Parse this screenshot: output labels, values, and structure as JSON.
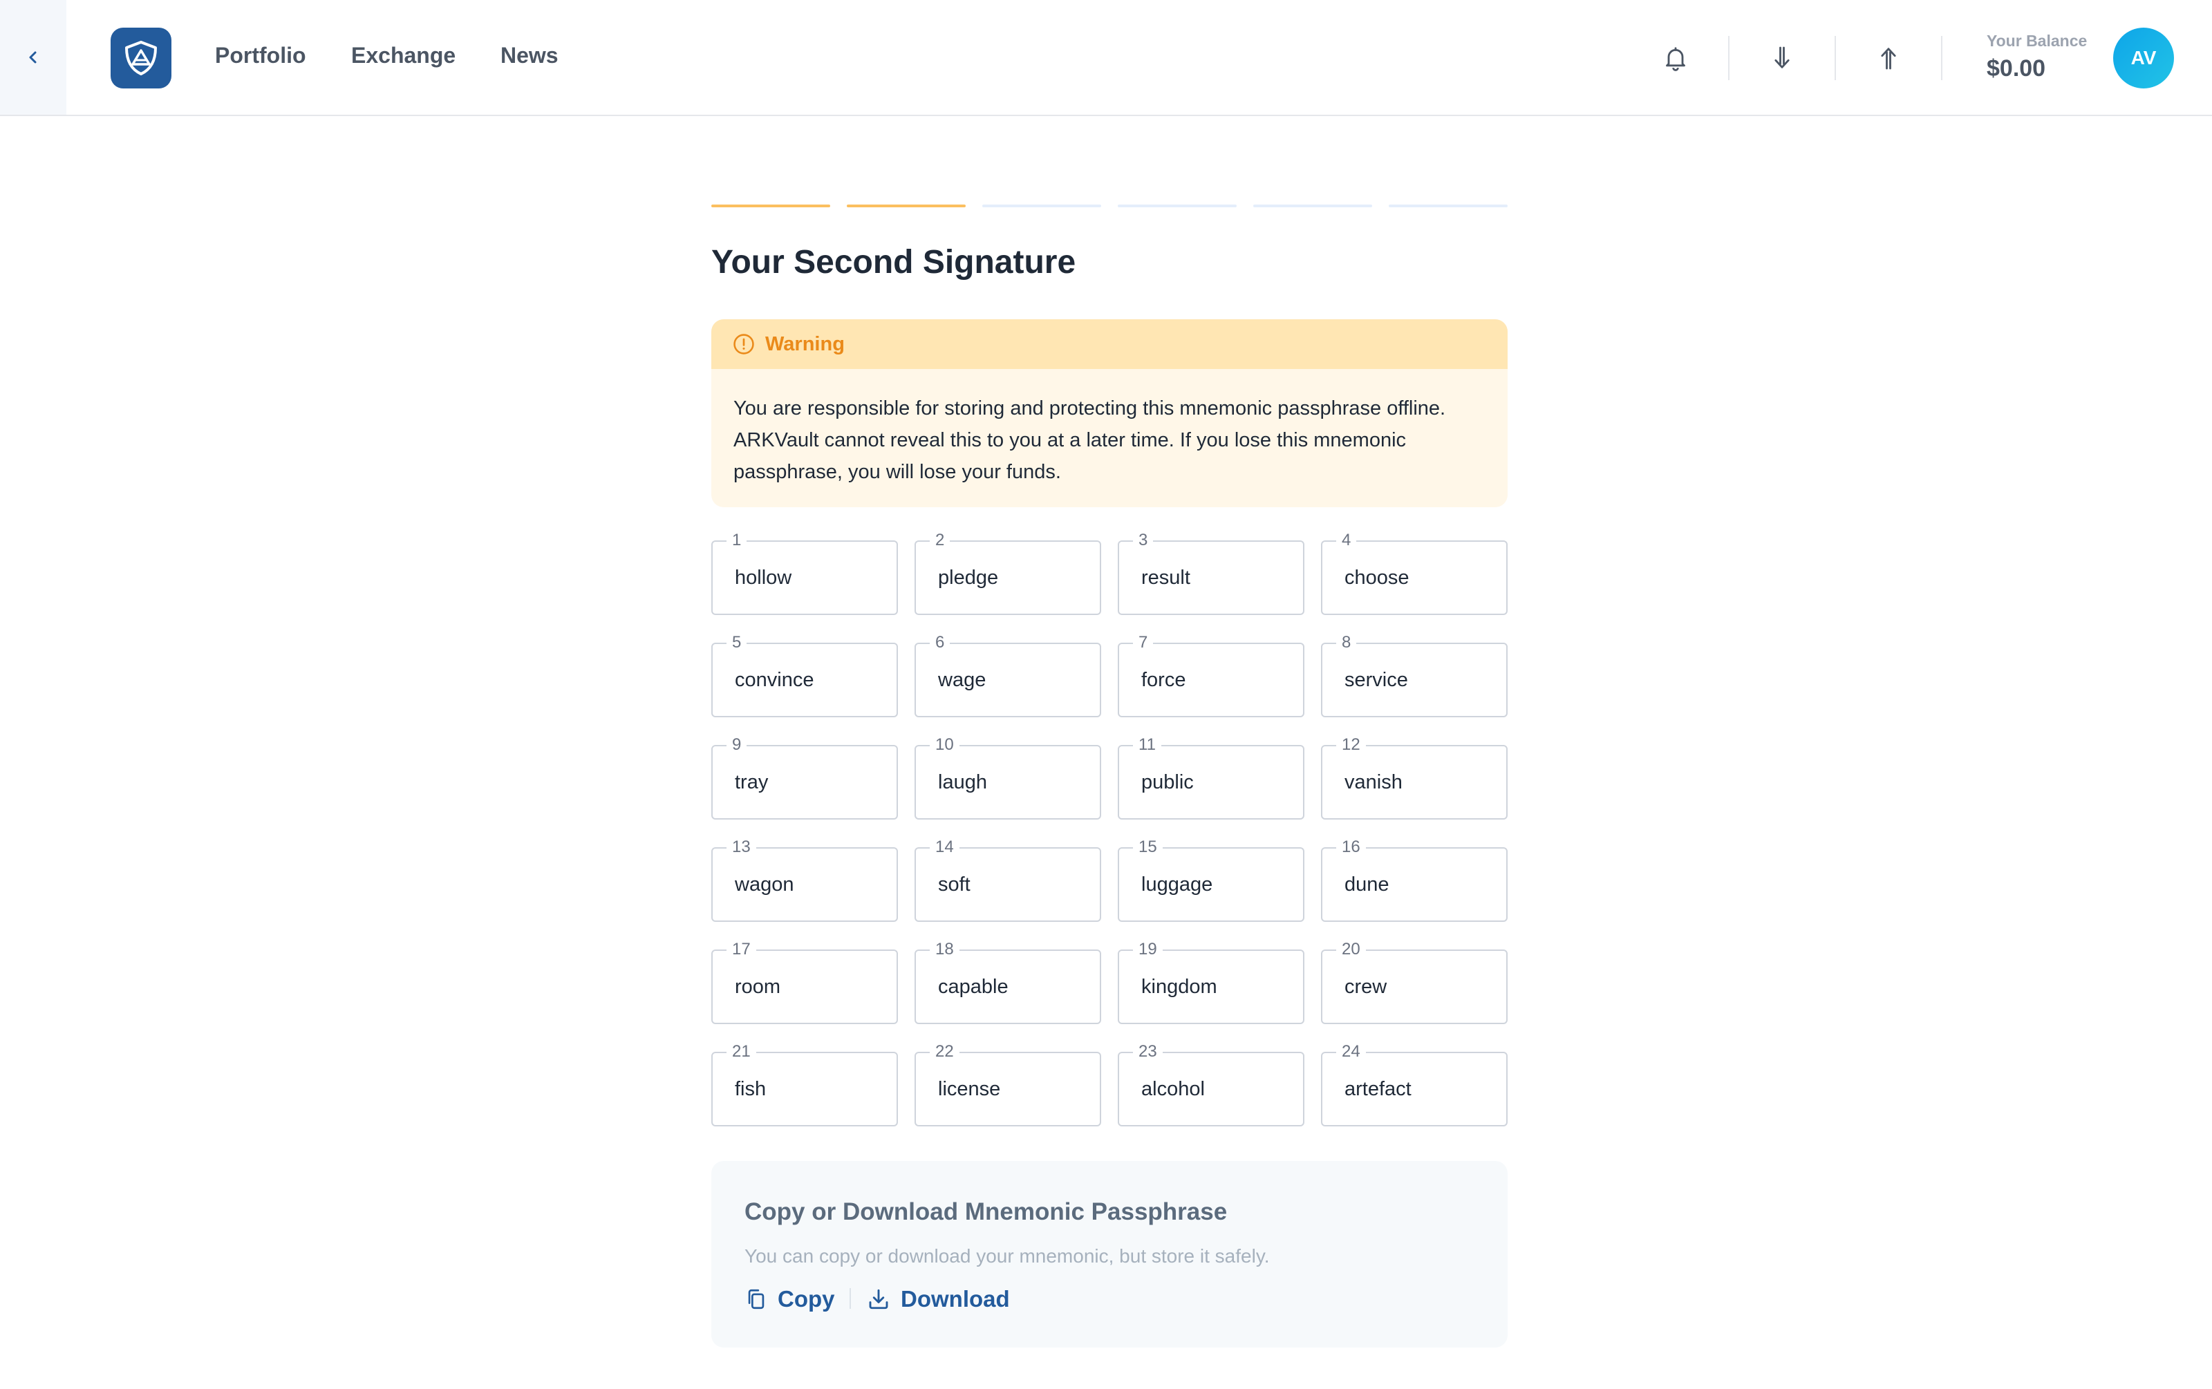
{
  "header": {
    "nav": [
      {
        "label": "Portfolio"
      },
      {
        "label": "Exchange"
      },
      {
        "label": "News"
      }
    ],
    "balance_label": "Your Balance",
    "balance_value": "$0.00",
    "avatar_initials": "AV"
  },
  "progress": {
    "total_steps": 6,
    "completed_steps": 2
  },
  "page": {
    "title": "Your Second Signature"
  },
  "warning": {
    "title": "Warning",
    "body": "You are responsible for storing and protecting this mnemonic passphrase offline. ARKVault cannot reveal this to you at a later time. If you lose this mnemonic passphrase, you will lose your funds."
  },
  "mnemonic": [
    {
      "num": "1",
      "word": "hollow"
    },
    {
      "num": "2",
      "word": "pledge"
    },
    {
      "num": "3",
      "word": "result"
    },
    {
      "num": "4",
      "word": "choose"
    },
    {
      "num": "5",
      "word": "convince"
    },
    {
      "num": "6",
      "word": "wage"
    },
    {
      "num": "7",
      "word": "force"
    },
    {
      "num": "8",
      "word": "service"
    },
    {
      "num": "9",
      "word": "tray"
    },
    {
      "num": "10",
      "word": "laugh"
    },
    {
      "num": "11",
      "word": "public"
    },
    {
      "num": "12",
      "word": "vanish"
    },
    {
      "num": "13",
      "word": "wagon"
    },
    {
      "num": "14",
      "word": "soft"
    },
    {
      "num": "15",
      "word": "luggage"
    },
    {
      "num": "16",
      "word": "dune"
    },
    {
      "num": "17",
      "word": "room"
    },
    {
      "num": "18",
      "word": "capable"
    },
    {
      "num": "19",
      "word": "kingdom"
    },
    {
      "num": "20",
      "word": "crew"
    },
    {
      "num": "21",
      "word": "fish"
    },
    {
      "num": "22",
      "word": "license"
    },
    {
      "num": "23",
      "word": "alcohol"
    },
    {
      "num": "24",
      "word": "artefact"
    }
  ],
  "copy_section": {
    "title": "Copy or Download Mnemonic Passphrase",
    "subtitle": "You can copy or download your mnemonic, but store it safely.",
    "copy_label": "Copy",
    "download_label": "Download"
  },
  "colors": {
    "brand": "#235b9c",
    "warning_accent": "#ea8a1a",
    "warning_head_bg": "#ffe6b3",
    "step_done": "#fbbf5f",
    "step_pending": "#e4eefb"
  },
  "icons": {
    "back": "chevron-left-icon",
    "logo": "shield-logo-icon",
    "notifications": "bell-icon",
    "receive": "arrow-down-icon",
    "send": "arrow-up-icon",
    "warning": "alert-circle-icon",
    "copy": "copy-icon",
    "download": "download-icon"
  }
}
